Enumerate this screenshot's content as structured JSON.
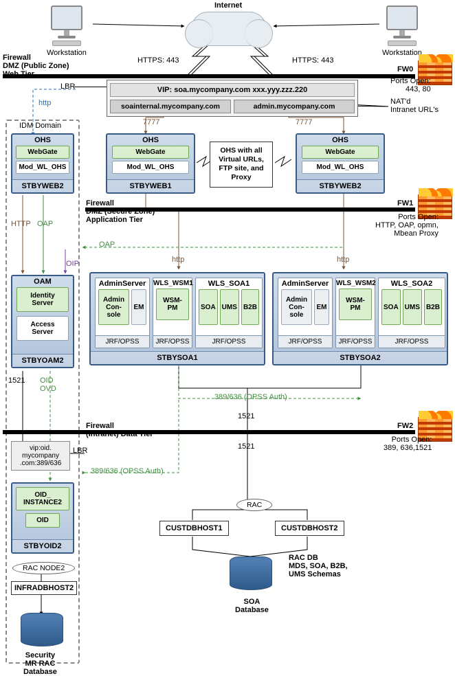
{
  "internet": "Internet",
  "workstation": "Workstation",
  "https": "HTTPS: 443",
  "fw_dmz_web": "Firewall\nDMZ (Public Zone)\nWeb Tier",
  "fw0": "FW0",
  "fw0_ports": "Ports Open:\n443, 80",
  "lbr": "LBR",
  "vip_line": "VIP: soa.mycompany.com    xxx.yyy.zzz.220",
  "soainternal": "soainternal.mycompany.com",
  "adminurl": "admin.mycompany.com",
  "nat": "NAT'd\nIntranet URL's",
  "http": "http",
  "p7777": "7777",
  "idm_domain": "IDM Domain",
  "ohs": "OHS",
  "webgate": "WebGate",
  "modwl": "Mod_WL_OHS",
  "stbyweb1": "STBYWEB1",
  "stbyweb2": "STBYWEB2",
  "callout": "OHS with all\nVirtual URLs,\nFTP site, and\nProxy",
  "fw_secure": "Firewall\nDMZ (Secure Zone)\nApplication Tier",
  "fw1": "FW1",
  "fw1_ports": "Ports Open:\nHTTP, OAP, opmn,\nMbean Proxy",
  "HTTP": "HTTP",
  "OAP": "OAP",
  "OIP": "OIP",
  "oam": "OAM",
  "identity": "Identity\nServer",
  "access": "Access\nServer",
  "stbyoam2": "STBYOAM2",
  "adminserver": "AdminServer",
  "adminconsole": "Admin\nCon-\nsole",
  "em": "EM",
  "wls_wsm1": "WLS_WSM1",
  "wls_wsm2": "WLS_WSM2",
  "wsmpm": "WSM-\nPM",
  "wls_soa1": "WLS_SOA1",
  "wls_soa2": "WLS_SOA2",
  "soa": "SOA",
  "ums": "UMS",
  "b2b": "B2B",
  "jrf": "JRF/OPSS",
  "stbysoa1": "STBYSOA1",
  "stbysoa2": "STBYSOA2",
  "p1521": "1521",
  "oid_ovd": "OID\nOVD",
  "opss": "389/636 (OPSS Auth)",
  "fw_intranet": "Firewall\n(Intranet) Data Tier",
  "fw2": "FW2",
  "fw2_ports": "Ports Open:\n389, 636,1521",
  "vip_oid": "vip:oid.\nmycompany\n.com:389/636",
  "oid_instance": "OID_\nINSTANCE2",
  "oid": "OID",
  "stbyoid2": "STBYOID2",
  "racnode2": "RAC NODE2",
  "infradbhost2": "INFRADBHOST2",
  "sec_db": "Security\nMR RAC\nDatabase",
  "rac": "RAC",
  "custdbhost1": "CUSTDBHOST1",
  "custdbhost2": "CUSTDBHOST2",
  "racdb": "RAC DB\nMDS, SOA, B2B,\nUMS Schemas",
  "soadb": "SOA\nDatabase"
}
